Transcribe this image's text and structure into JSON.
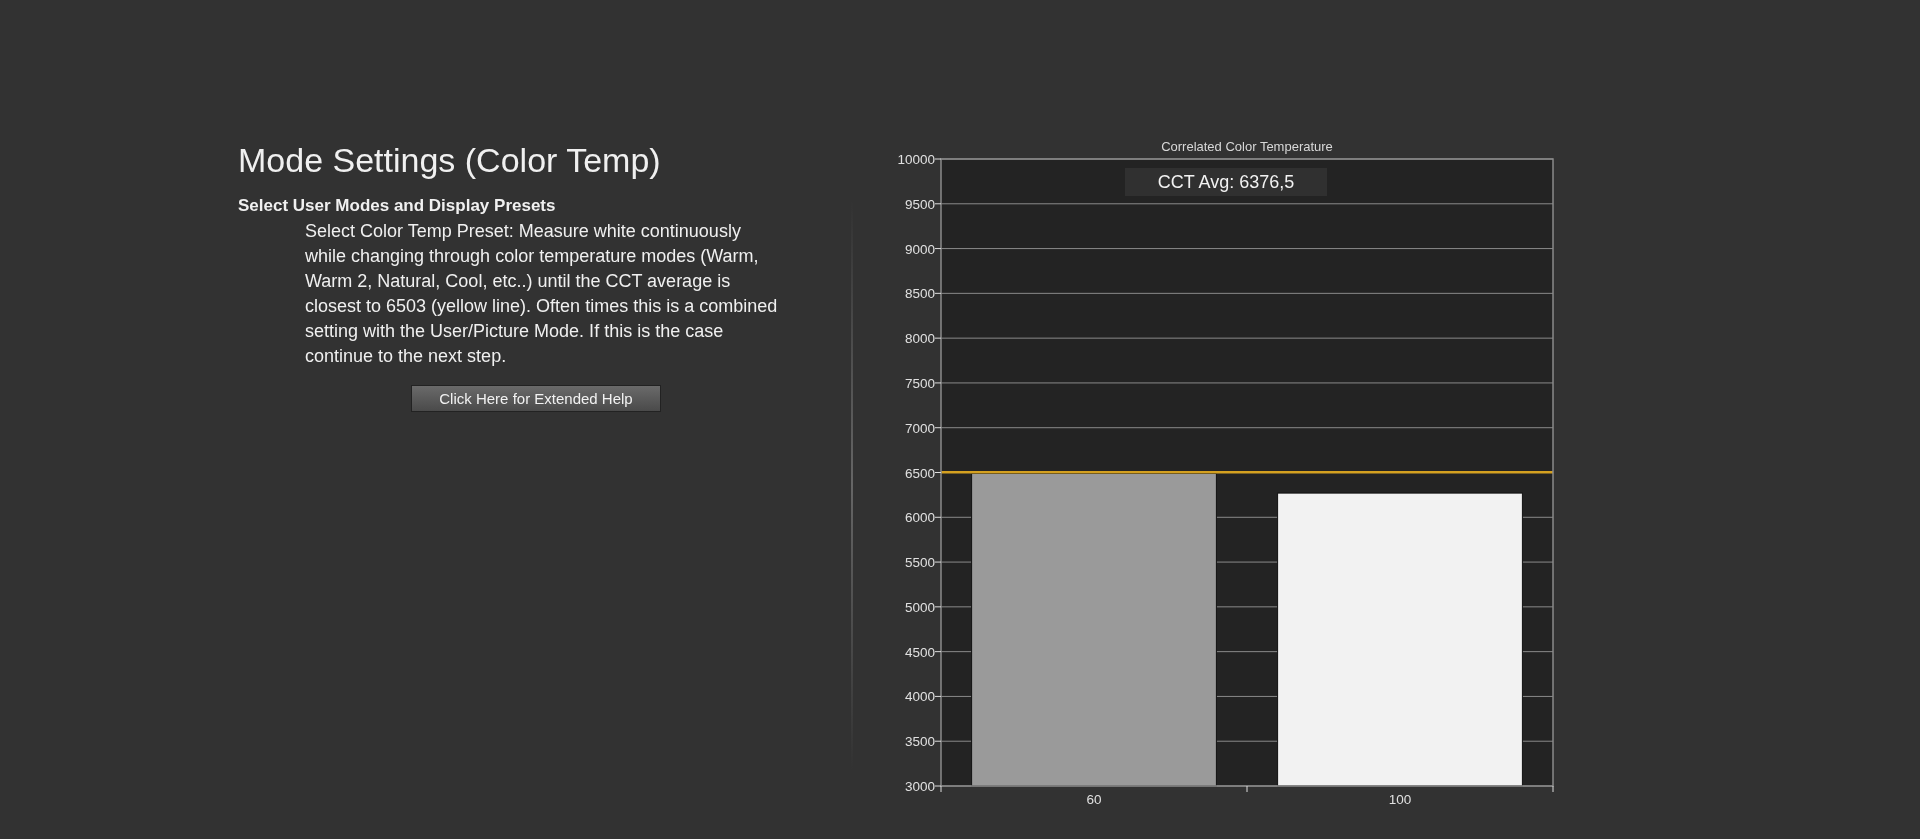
{
  "heading": "Mode Settings (Color Temp)",
  "section": {
    "title": "Select User Modes and Display Presets",
    "body": "Select Color Temp Preset: Measure white continuously while changing through color temperature modes (Warm, Warm 2, Natural, Cool, etc..) until the CCT average is closest to 6503 (yellow line). Often times this is a combined setting with the User/Picture Mode. If this is the case continue to the next step."
  },
  "help_button": "Click Here for Extended Help",
  "chart_data": {
    "type": "bar",
    "title": "Correlated Color Temperature",
    "categories": [
      "60",
      "100"
    ],
    "series": [
      {
        "color": "#9a9a9a",
        "values": [
          6490,
          null
        ]
      },
      {
        "color": "#f2f2f2",
        "values": [
          null,
          6270
        ]
      }
    ],
    "grid": true,
    "ref_lines": [
      {
        "axis": "y",
        "value": 6503,
        "color": "#d4a020"
      }
    ],
    "ylim": [
      3000,
      10000
    ],
    "yticks": [
      3000,
      3500,
      4000,
      4500,
      5000,
      5500,
      6000,
      6500,
      7000,
      7500,
      8000,
      8500,
      9000,
      9500,
      10000
    ],
    "annotations": [
      {
        "text": "CCT Avg: 6376,5"
      }
    ]
  }
}
